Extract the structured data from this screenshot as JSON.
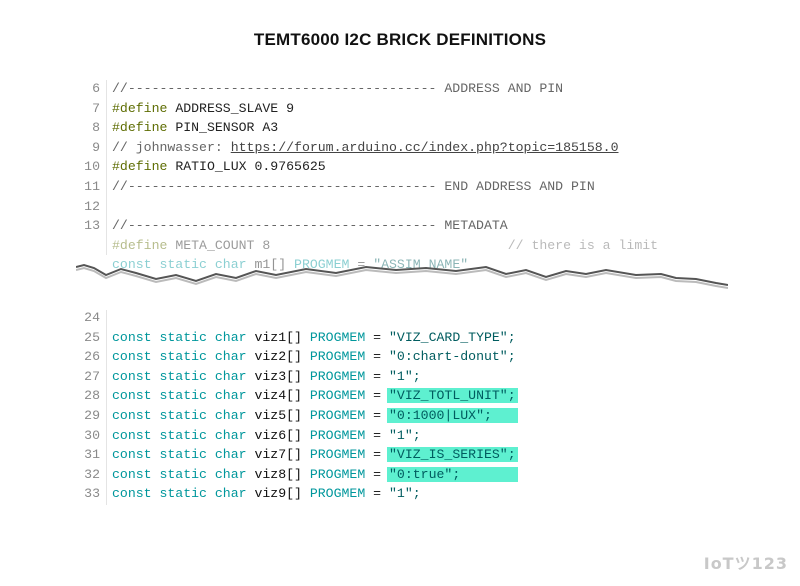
{
  "title": "TEMT6000 I2C BRICK DEFINITIONS",
  "logo": "IoTツ123",
  "highlight_color": "#5ef0d0",
  "top_block": [
    {
      "n": "6",
      "parts": [
        {
          "c": "comment",
          "t": "//--------------------------------------- ADDRESS AND PIN"
        }
      ]
    },
    {
      "n": "7",
      "parts": [
        {
          "c": "pre",
          "t": "#define"
        },
        {
          "c": "plain",
          "t": " ADDRESS_SLAVE 9"
        }
      ]
    },
    {
      "n": "8",
      "parts": [
        {
          "c": "pre",
          "t": "#define"
        },
        {
          "c": "plain",
          "t": " PIN_SENSOR A3"
        }
      ]
    },
    {
      "n": "9",
      "parts": [
        {
          "c": "comment",
          "t": "// johnwasser: "
        },
        {
          "c": "url",
          "t": "https://forum.arduino.cc/index.php?topic=185158.0"
        }
      ]
    },
    {
      "n": "10",
      "parts": [
        {
          "c": "pre",
          "t": "#define"
        },
        {
          "c": "plain",
          "t": " RATIO_LUX 0.9765625"
        }
      ]
    },
    {
      "n": "11",
      "parts": [
        {
          "c": "comment",
          "t": "//--------------------------------------- END ADDRESS AND PIN"
        }
      ]
    },
    {
      "n": "12",
      "parts": []
    },
    {
      "n": "13",
      "parts": [
        {
          "c": "comment",
          "t": "//--------------------------------------- METADATA"
        }
      ]
    },
    {
      "n": "",
      "faded": true,
      "parts": [
        {
          "c": "pre",
          "t": "#define"
        },
        {
          "c": "plain",
          "t": " META_COUNT 8                              "
        },
        {
          "c": "comment",
          "t": "// there is a limit"
        }
      ]
    },
    {
      "n": "",
      "faded": true,
      "parts": [
        {
          "c": "kw",
          "t": "const static char"
        },
        {
          "c": "ident",
          "t": " m1[] "
        },
        {
          "c": "pm",
          "t": "PROGMEM"
        },
        {
          "c": "plain",
          "t": " = "
        },
        {
          "c": "str",
          "t": "\"ASSIM_NAME\""
        }
      ]
    }
  ],
  "bottom_block": [
    {
      "n": "24",
      "parts": []
    },
    {
      "n": "25",
      "parts": [
        {
          "c": "kw",
          "t": "const static char"
        },
        {
          "c": "ident",
          "t": " viz1[] "
        },
        {
          "c": "pm",
          "t": "PROGMEM"
        },
        {
          "c": "plain",
          "t": " = "
        },
        {
          "c": "str",
          "t": "\"VIZ_CARD_TYPE\";"
        }
      ]
    },
    {
      "n": "26",
      "parts": [
        {
          "c": "kw",
          "t": "const static char"
        },
        {
          "c": "ident",
          "t": " viz2[] "
        },
        {
          "c": "pm",
          "t": "PROGMEM"
        },
        {
          "c": "plain",
          "t": " = "
        },
        {
          "c": "str",
          "t": "\"0:chart-donut\";"
        }
      ]
    },
    {
      "n": "27",
      "parts": [
        {
          "c": "kw",
          "t": "const static char"
        },
        {
          "c": "ident",
          "t": " viz3[] "
        },
        {
          "c": "pm",
          "t": "PROGMEM"
        },
        {
          "c": "plain",
          "t": " = "
        },
        {
          "c": "str",
          "t": "\"1\";"
        }
      ]
    },
    {
      "n": "28",
      "parts": [
        {
          "c": "kw",
          "t": "const static char"
        },
        {
          "c": "ident",
          "t": " viz4[] "
        },
        {
          "c": "pm",
          "t": "PROGMEM"
        },
        {
          "c": "plain",
          "t": " = "
        },
        {
          "c": "str hl",
          "t": "\"VIZ_TOTL_UNIT\";"
        }
      ]
    },
    {
      "n": "29",
      "parts": [
        {
          "c": "kw",
          "t": "const static char"
        },
        {
          "c": "ident",
          "t": " viz5[] "
        },
        {
          "c": "pm",
          "t": "PROGMEM"
        },
        {
          "c": "plain",
          "t": " = "
        },
        {
          "c": "str hl",
          "t": "\"0:1000|LUX\";   "
        }
      ]
    },
    {
      "n": "30",
      "parts": [
        {
          "c": "kw",
          "t": "const static char"
        },
        {
          "c": "ident",
          "t": " viz6[] "
        },
        {
          "c": "pm",
          "t": "PROGMEM"
        },
        {
          "c": "plain",
          "t": " = "
        },
        {
          "c": "str",
          "t": "\"1\";"
        }
      ]
    },
    {
      "n": "31",
      "parts": [
        {
          "c": "kw",
          "t": "const static char"
        },
        {
          "c": "ident",
          "t": " viz7[] "
        },
        {
          "c": "pm",
          "t": "PROGMEM"
        },
        {
          "c": "plain",
          "t": " = "
        },
        {
          "c": "str hl",
          "t": "\"VIZ_IS_SERIES\";"
        }
      ]
    },
    {
      "n": "32",
      "parts": [
        {
          "c": "kw",
          "t": "const static char"
        },
        {
          "c": "ident",
          "t": " viz8[] "
        },
        {
          "c": "pm",
          "t": "PROGMEM"
        },
        {
          "c": "plain",
          "t": " = "
        },
        {
          "c": "str hl",
          "t": "\"0:true\";       "
        }
      ]
    },
    {
      "n": "33",
      "parts": [
        {
          "c": "kw",
          "t": "const static char"
        },
        {
          "c": "ident",
          "t": " viz9[] "
        },
        {
          "c": "pm",
          "t": "PROGMEM"
        },
        {
          "c": "plain",
          "t": " = "
        },
        {
          "c": "str",
          "t": "\"1\";"
        }
      ]
    }
  ]
}
